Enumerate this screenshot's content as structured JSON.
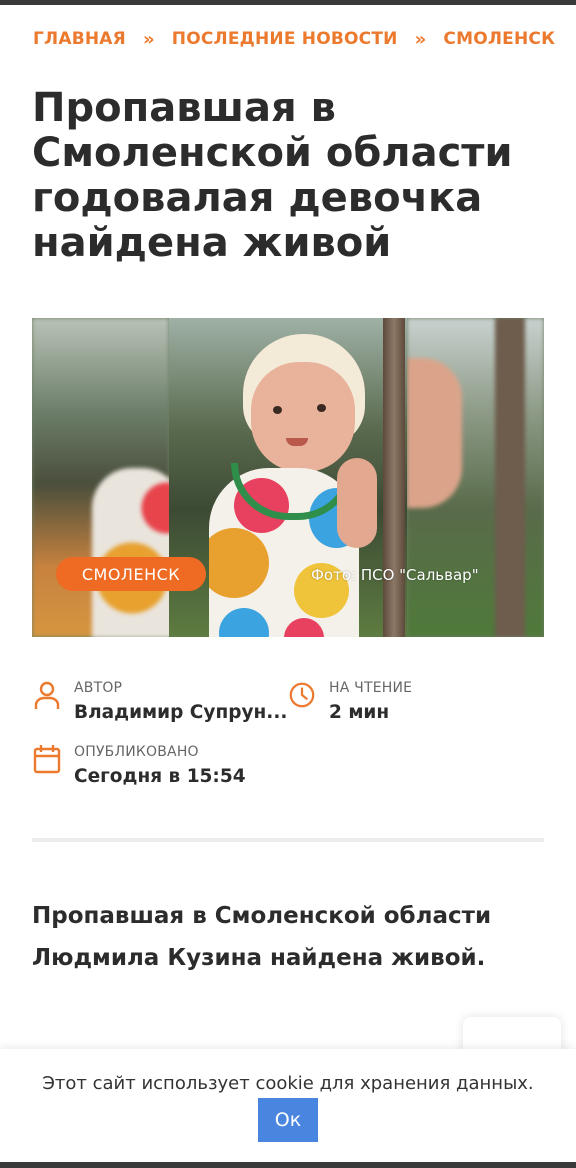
{
  "breadcrumb": {
    "items": [
      "ГЛАВНАЯ",
      "ПОСЛЕДНИЕ НОВОСТИ",
      "СМОЛЕНСК"
    ],
    "separator": "»"
  },
  "article": {
    "title": "Пропавшая в Смоленской области годовалая девочка найдена живой",
    "category_badge": "СМОЛЕНСК",
    "photo_credit": "Фото: ПСО \"Сальвар\"",
    "lead": "Пропавшая в Смоленской области Людмила Кузина найдена живой."
  },
  "meta": {
    "author_label": "АВТОР",
    "author_value": "Владимир Супрун...",
    "reading_label": "НА ЧТЕНИЕ",
    "reading_value": "2 мин",
    "published_label": "ОПУБЛИКОВАНО",
    "published_value": "Сегодня в 15:54"
  },
  "cookie": {
    "text": "Этот сайт использует cookie для хранения данных.",
    "button_label": "Ок"
  },
  "colors": {
    "accent": "#ec7a2e",
    "badge": "#ef6a22",
    "button": "#4a86e0"
  }
}
